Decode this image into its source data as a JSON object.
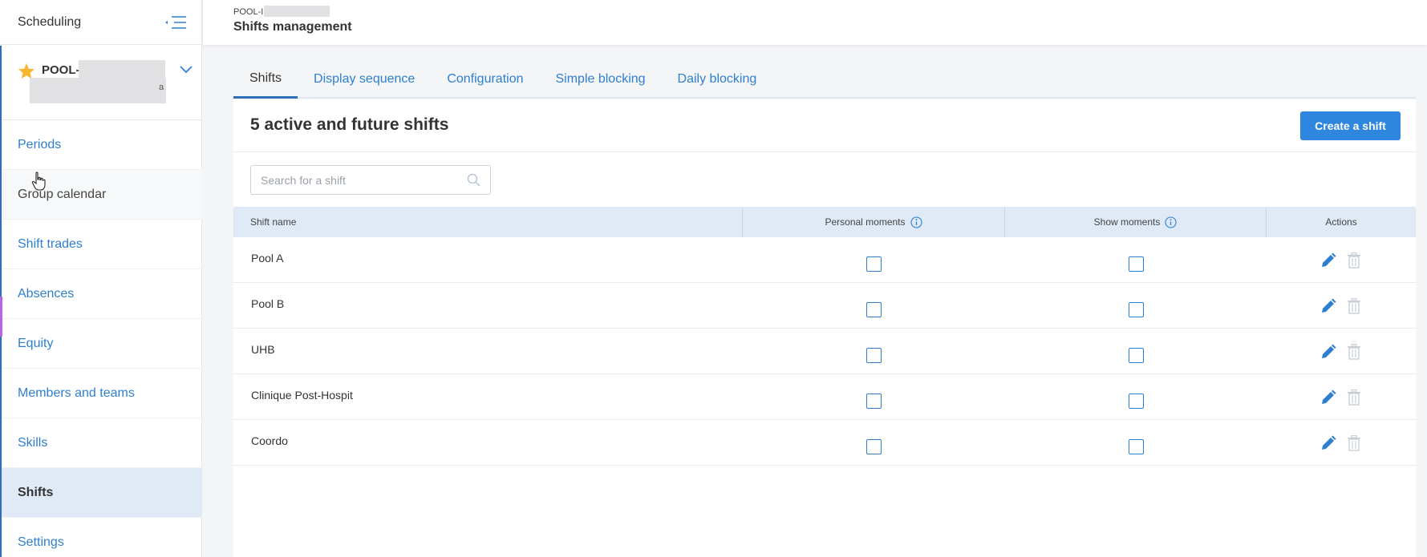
{
  "sidebar": {
    "title": "Scheduling",
    "pool": {
      "name": "POOL-",
      "subtitle": "a"
    },
    "items": [
      {
        "label": "Periods"
      },
      {
        "label": "Group calendar"
      },
      {
        "label": "Shift trades"
      },
      {
        "label": "Absences"
      },
      {
        "label": "Equity"
      },
      {
        "label": "Members and teams"
      },
      {
        "label": "Skills"
      },
      {
        "label": "Shifts"
      },
      {
        "label": "Settings"
      }
    ],
    "active_item": "Shifts"
  },
  "header": {
    "breadcrumb": "POOL-I",
    "title": "Shifts management"
  },
  "tabs": [
    {
      "label": "Shifts"
    },
    {
      "label": "Display sequence"
    },
    {
      "label": "Configuration"
    },
    {
      "label": "Simple blocking"
    },
    {
      "label": "Daily blocking"
    }
  ],
  "active_tab": "Shifts",
  "card": {
    "title": "5 active and future shifts",
    "create_label": "Create a shift"
  },
  "search": {
    "placeholder": "Search for a shift",
    "value": ""
  },
  "table": {
    "headers": {
      "name": "Shift name",
      "personal": "Personal moments",
      "show": "Show moments",
      "actions": "Actions"
    },
    "rows": [
      {
        "name": "Pool A",
        "personal_moments": false,
        "show_moments": false
      },
      {
        "name": "Pool B",
        "personal_moments": false,
        "show_moments": false
      },
      {
        "name": "UHB",
        "personal_moments": false,
        "show_moments": false
      },
      {
        "name": "Clinique Post-Hospit",
        "personal_moments": false,
        "show_moments": false
      },
      {
        "name": "Coordo",
        "personal_moments": false,
        "show_moments": false
      }
    ]
  },
  "icons": {
    "collapse": "menu-collapse-icon",
    "star": "star-icon",
    "chevron": "chevron-down-icon",
    "search": "search-icon",
    "info": "info-icon",
    "edit": "pencil-icon",
    "delete": "trash-icon"
  },
  "colors": {
    "accent": "#2e86de",
    "link": "#2e7fd0",
    "star": "#f5b731",
    "header_bg": "#dfeaf6",
    "nav_accent": "#b565e6"
  }
}
